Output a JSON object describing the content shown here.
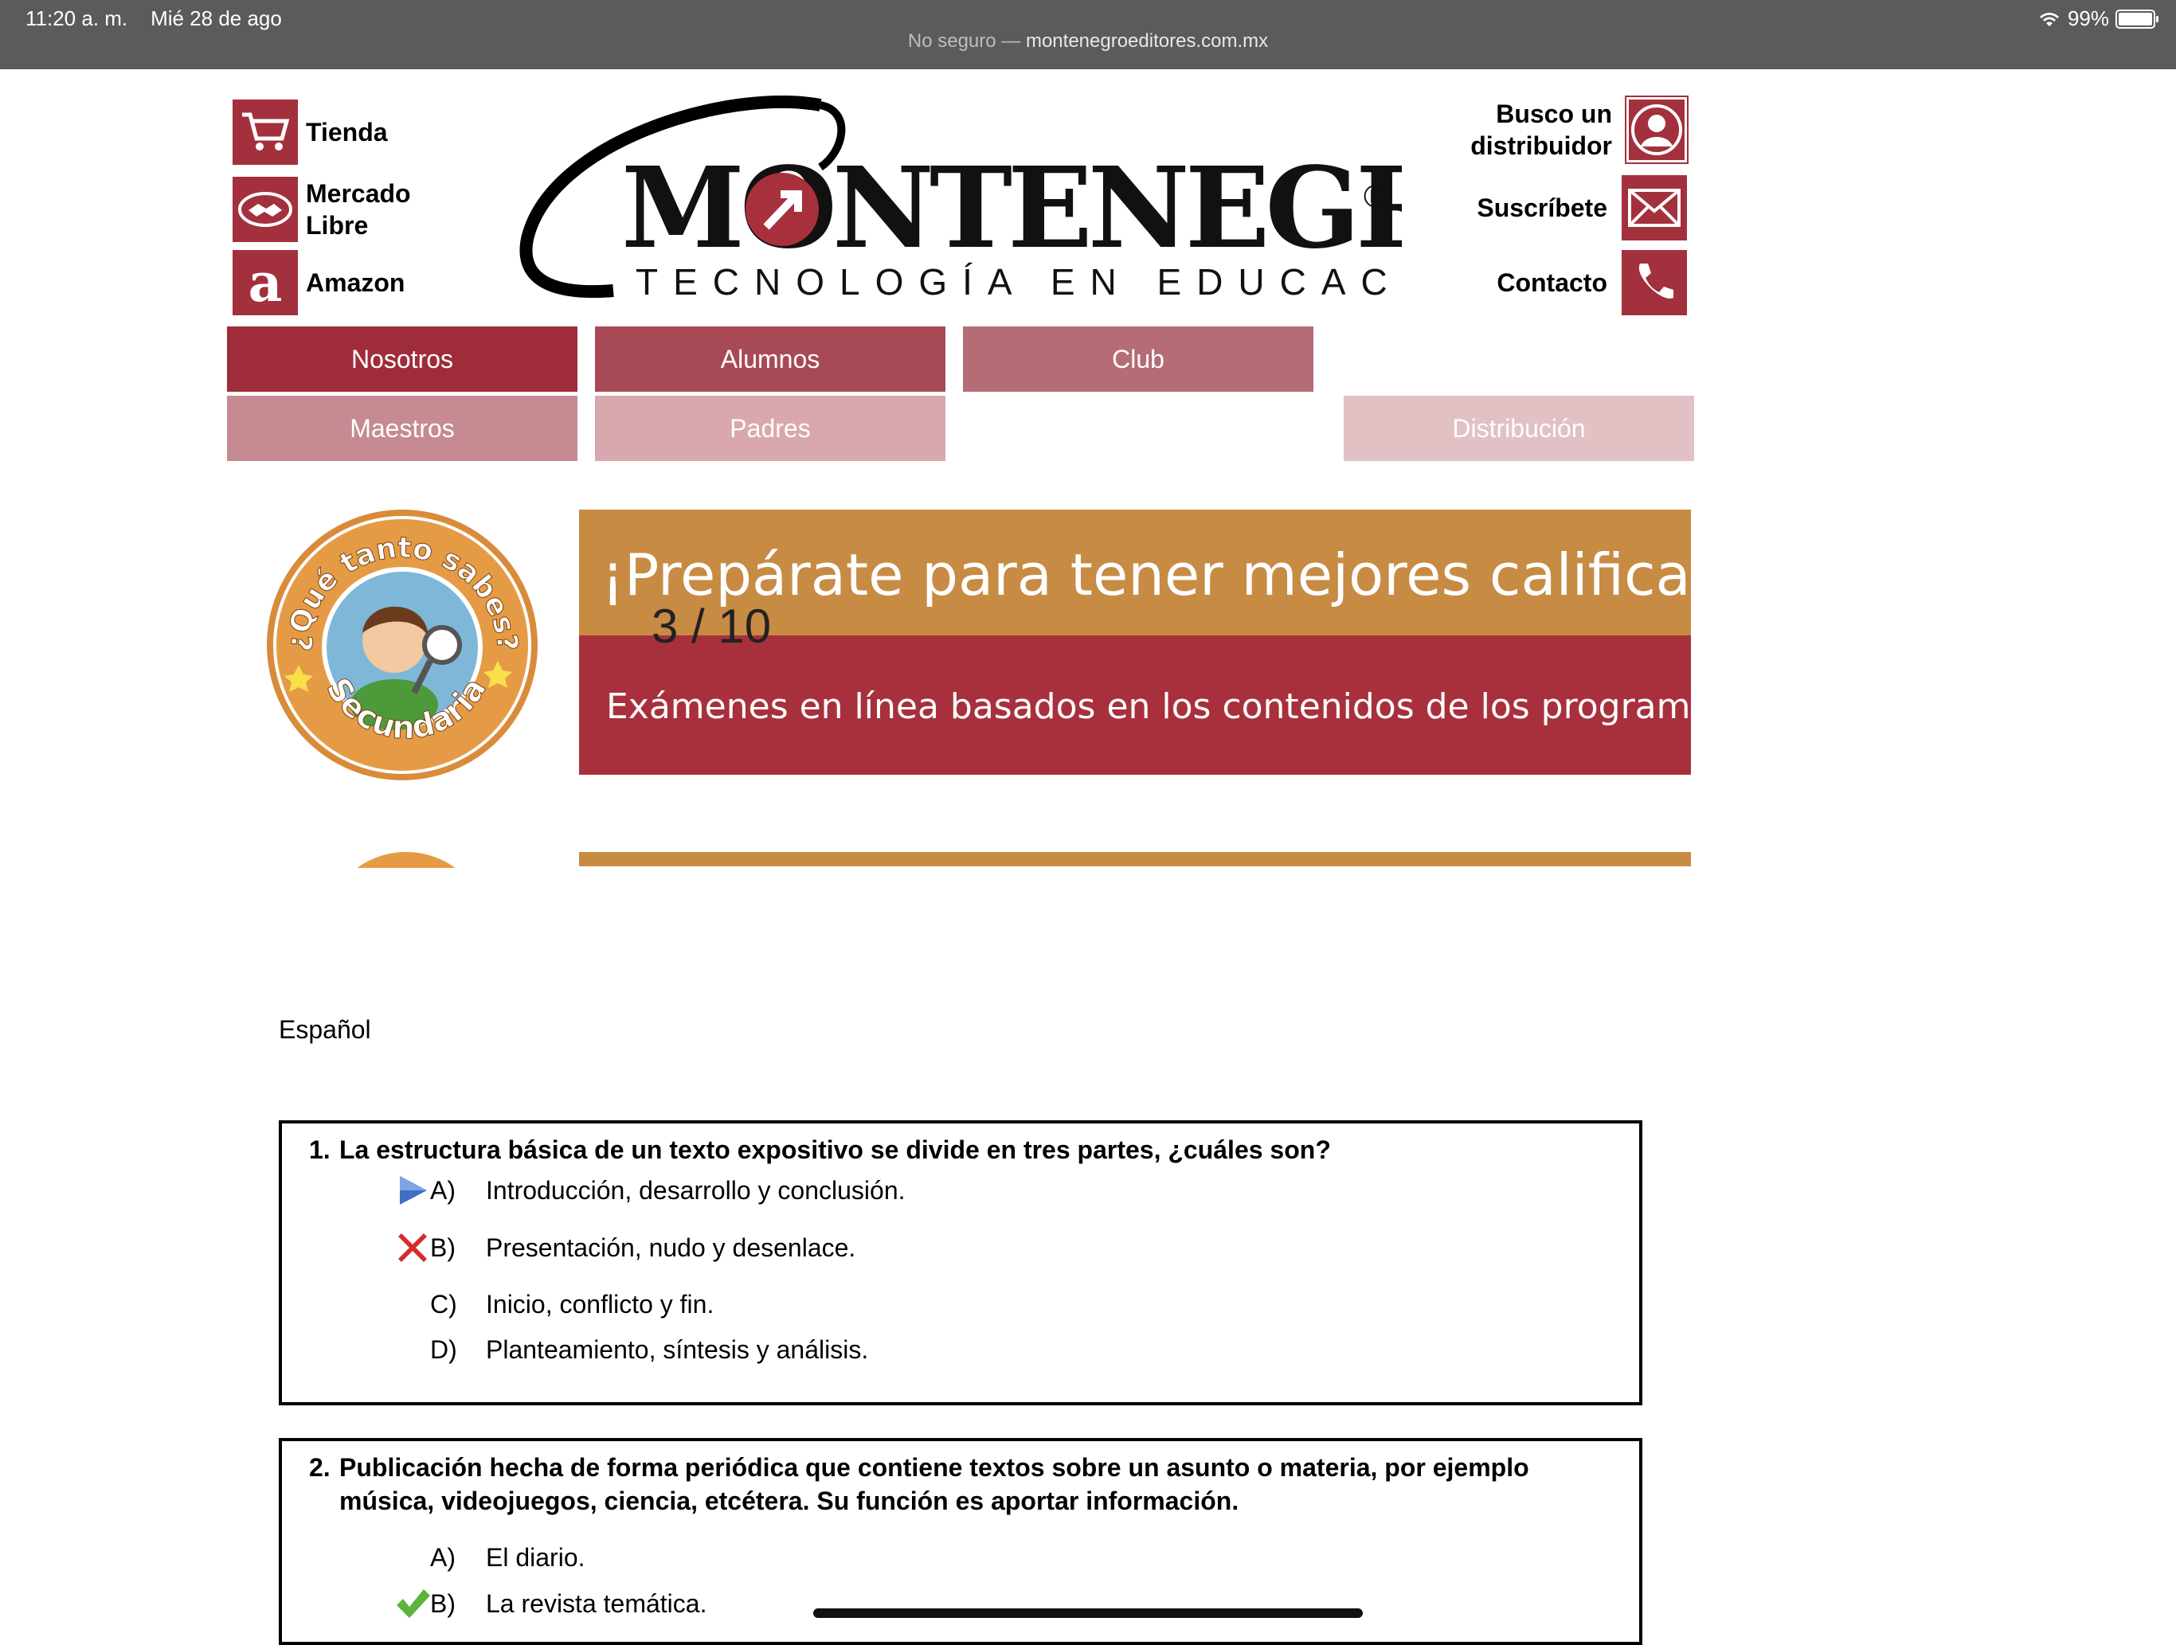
{
  "status_bar": {
    "time": "11:20 a. m.",
    "date": "Mié 28 de ago",
    "not_secure": "No seguro —",
    "domain": "montenegroeditores.com.mx",
    "battery": "99%"
  },
  "header": {
    "left_links": [
      {
        "label": "Tienda",
        "icon": "cart-icon"
      },
      {
        "label": "Mercado Libre",
        "icon": "handshake-icon"
      },
      {
        "label": "Amazon",
        "icon": "amazon-icon"
      }
    ],
    "right_links": [
      {
        "label": "Busco un distribuidor",
        "icon": "person-search-icon"
      },
      {
        "label": "Suscríbete",
        "icon": "envelope-icon"
      },
      {
        "label": "Contacto",
        "icon": "phone-icon"
      }
    ],
    "logo": {
      "name": "MONTENEGRO",
      "tagline": "TECNOLOGÍA EN EDUCACIÓN",
      "registered": "®"
    }
  },
  "nav": {
    "row1": [
      {
        "label": "Nosotros",
        "color": "#9e2d39"
      },
      {
        "label": "Alumnos",
        "color": "#a84a55"
      },
      {
        "label": "Club",
        "color": "#b56c74"
      }
    ],
    "row2": [
      {
        "label": "Maestros",
        "color": "#c68a92"
      },
      {
        "label": "Padres",
        "color": "#d9a8ae"
      },
      {
        "label": "Distribución",
        "color": "#e2c1c5"
      }
    ]
  },
  "banner": {
    "badge_text_top": "¿Qué tanto sabes?",
    "badge_text_bottom": "Secundaria",
    "headline": "¡Prepárate para tener mejores calificaciones",
    "subline": "Exámenes en línea basados en los contenidos de los programas vigentes",
    "counter": "3 / 10",
    "colors": {
      "orange": "#c78b44",
      "red": "#a8303c"
    }
  },
  "quiz": {
    "subject": "Español",
    "questions": [
      {
        "number": "1.",
        "text": "La estructura básica de un texto expositivo se divide en tres partes, ¿cuáles son?",
        "options": [
          {
            "letter": "A)",
            "text": "Introducción, desarrollo y conclusión.",
            "mark": "play-arrow-icon"
          },
          {
            "letter": "B)",
            "text": "Presentación, nudo y desenlace.",
            "mark": "red-x-icon"
          },
          {
            "letter": "C)",
            "text": "Inicio, conflicto y fin.",
            "mark": ""
          },
          {
            "letter": "D)",
            "text": "Planteamiento, síntesis y análisis.",
            "mark": ""
          }
        ]
      },
      {
        "number": "2.",
        "text_line1": "Publicación hecha de forma periódica que contiene textos sobre un asunto o materia, por ejemplo",
        "text_line2": "música, videojuegos, ciencia, etcétera. Su función es aportar información.",
        "options": [
          {
            "letter": "A)",
            "text": "El diario.",
            "mark": ""
          },
          {
            "letter": "B)",
            "text": "La revista temática.",
            "mark": "green-check-icon"
          }
        ]
      }
    ]
  }
}
